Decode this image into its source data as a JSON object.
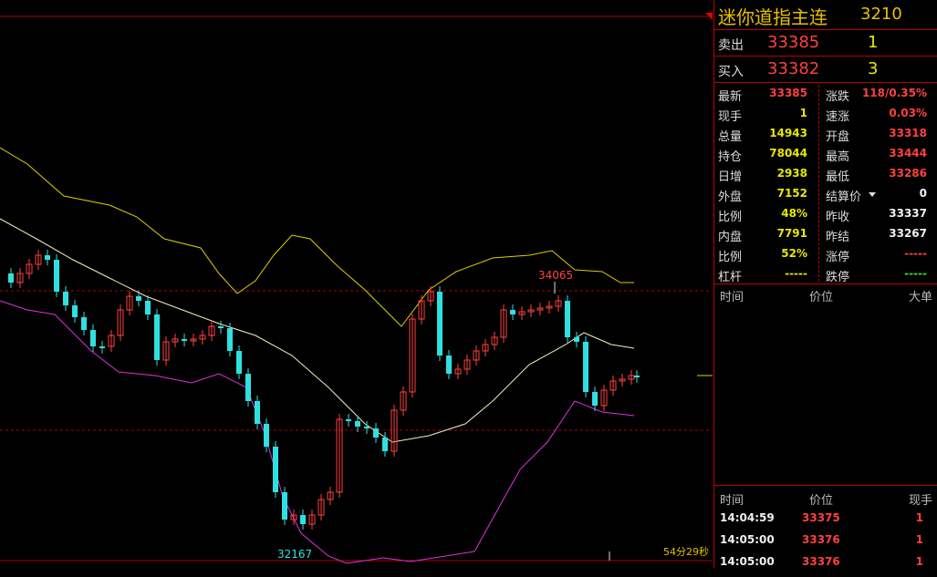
{
  "chart": {
    "high_label": "34065",
    "low_label": "32167",
    "countdown": "54分29秒",
    "colors": {
      "up": "#ff4040",
      "down": "#30e0e0",
      "mid": "#f0f0c0",
      "upper": "#e0d000",
      "lower": "#e030e0",
      "ref": "#b00000"
    }
  },
  "panel": {
    "name": "迷你道指主连",
    "code": "3210",
    "sell": {
      "label": "卖出",
      "price": "33385",
      "volume": "1"
    },
    "buy": {
      "label": "买入",
      "price": "33382",
      "volume": "3"
    },
    "stats": [
      {
        "l1": "最新",
        "v1": "33385",
        "c1": "red",
        "l2": "涨跌",
        "v2": "118/0.35%",
        "c2": "red"
      },
      {
        "l1": "现手",
        "v1": "1",
        "c1": "yel",
        "l2": "速涨",
        "v2": "0.03%",
        "c2": "red"
      },
      {
        "l1": "总量",
        "v1": "14943",
        "c1": "yel",
        "l2": "开盘",
        "v2": "33318",
        "c2": "red"
      },
      {
        "l1": "持仓",
        "v1": "78044",
        "c1": "yel",
        "l2": "最高",
        "v2": "33444",
        "c2": "red"
      },
      {
        "l1": "日增",
        "v1": "2938",
        "c1": "yel",
        "l2": "最低",
        "v2": "33286",
        "c2": "red"
      },
      {
        "l1": "外盘",
        "v1": "7152",
        "c1": "yel",
        "l2": "结算价",
        "v2": "0",
        "c2": "wht",
        "dropdown": true
      },
      {
        "l1": "比例",
        "v1": "48%",
        "c1": "yel",
        "l2": "昨收",
        "v2": "33337",
        "c2": "wht"
      },
      {
        "l1": "内盘",
        "v1": "7791",
        "c1": "yel",
        "l2": "昨结",
        "v2": "33267",
        "c2": "wht"
      },
      {
        "l1": "比例",
        "v1": "52%",
        "c1": "yel",
        "l2": "涨停",
        "v2": "-----",
        "c2": "red"
      },
      {
        "l1": "杠杆",
        "v1": "-----",
        "c1": "yel",
        "l2": "跌停",
        "v2": "-----",
        "c2": "grn"
      }
    ],
    "big_orders_header": {
      "time": "时间",
      "price": "价位",
      "big": "大单"
    },
    "trades_header": {
      "time": "时间",
      "price": "价位",
      "hand": "现手"
    },
    "trades": [
      {
        "time": "14:04:59",
        "price": "33375",
        "hand": "1"
      },
      {
        "time": "14:05:00",
        "price": "33376",
        "hand": "1"
      },
      {
        "time": "14:05:00",
        "price": "33376",
        "hand": "1"
      }
    ]
  }
}
